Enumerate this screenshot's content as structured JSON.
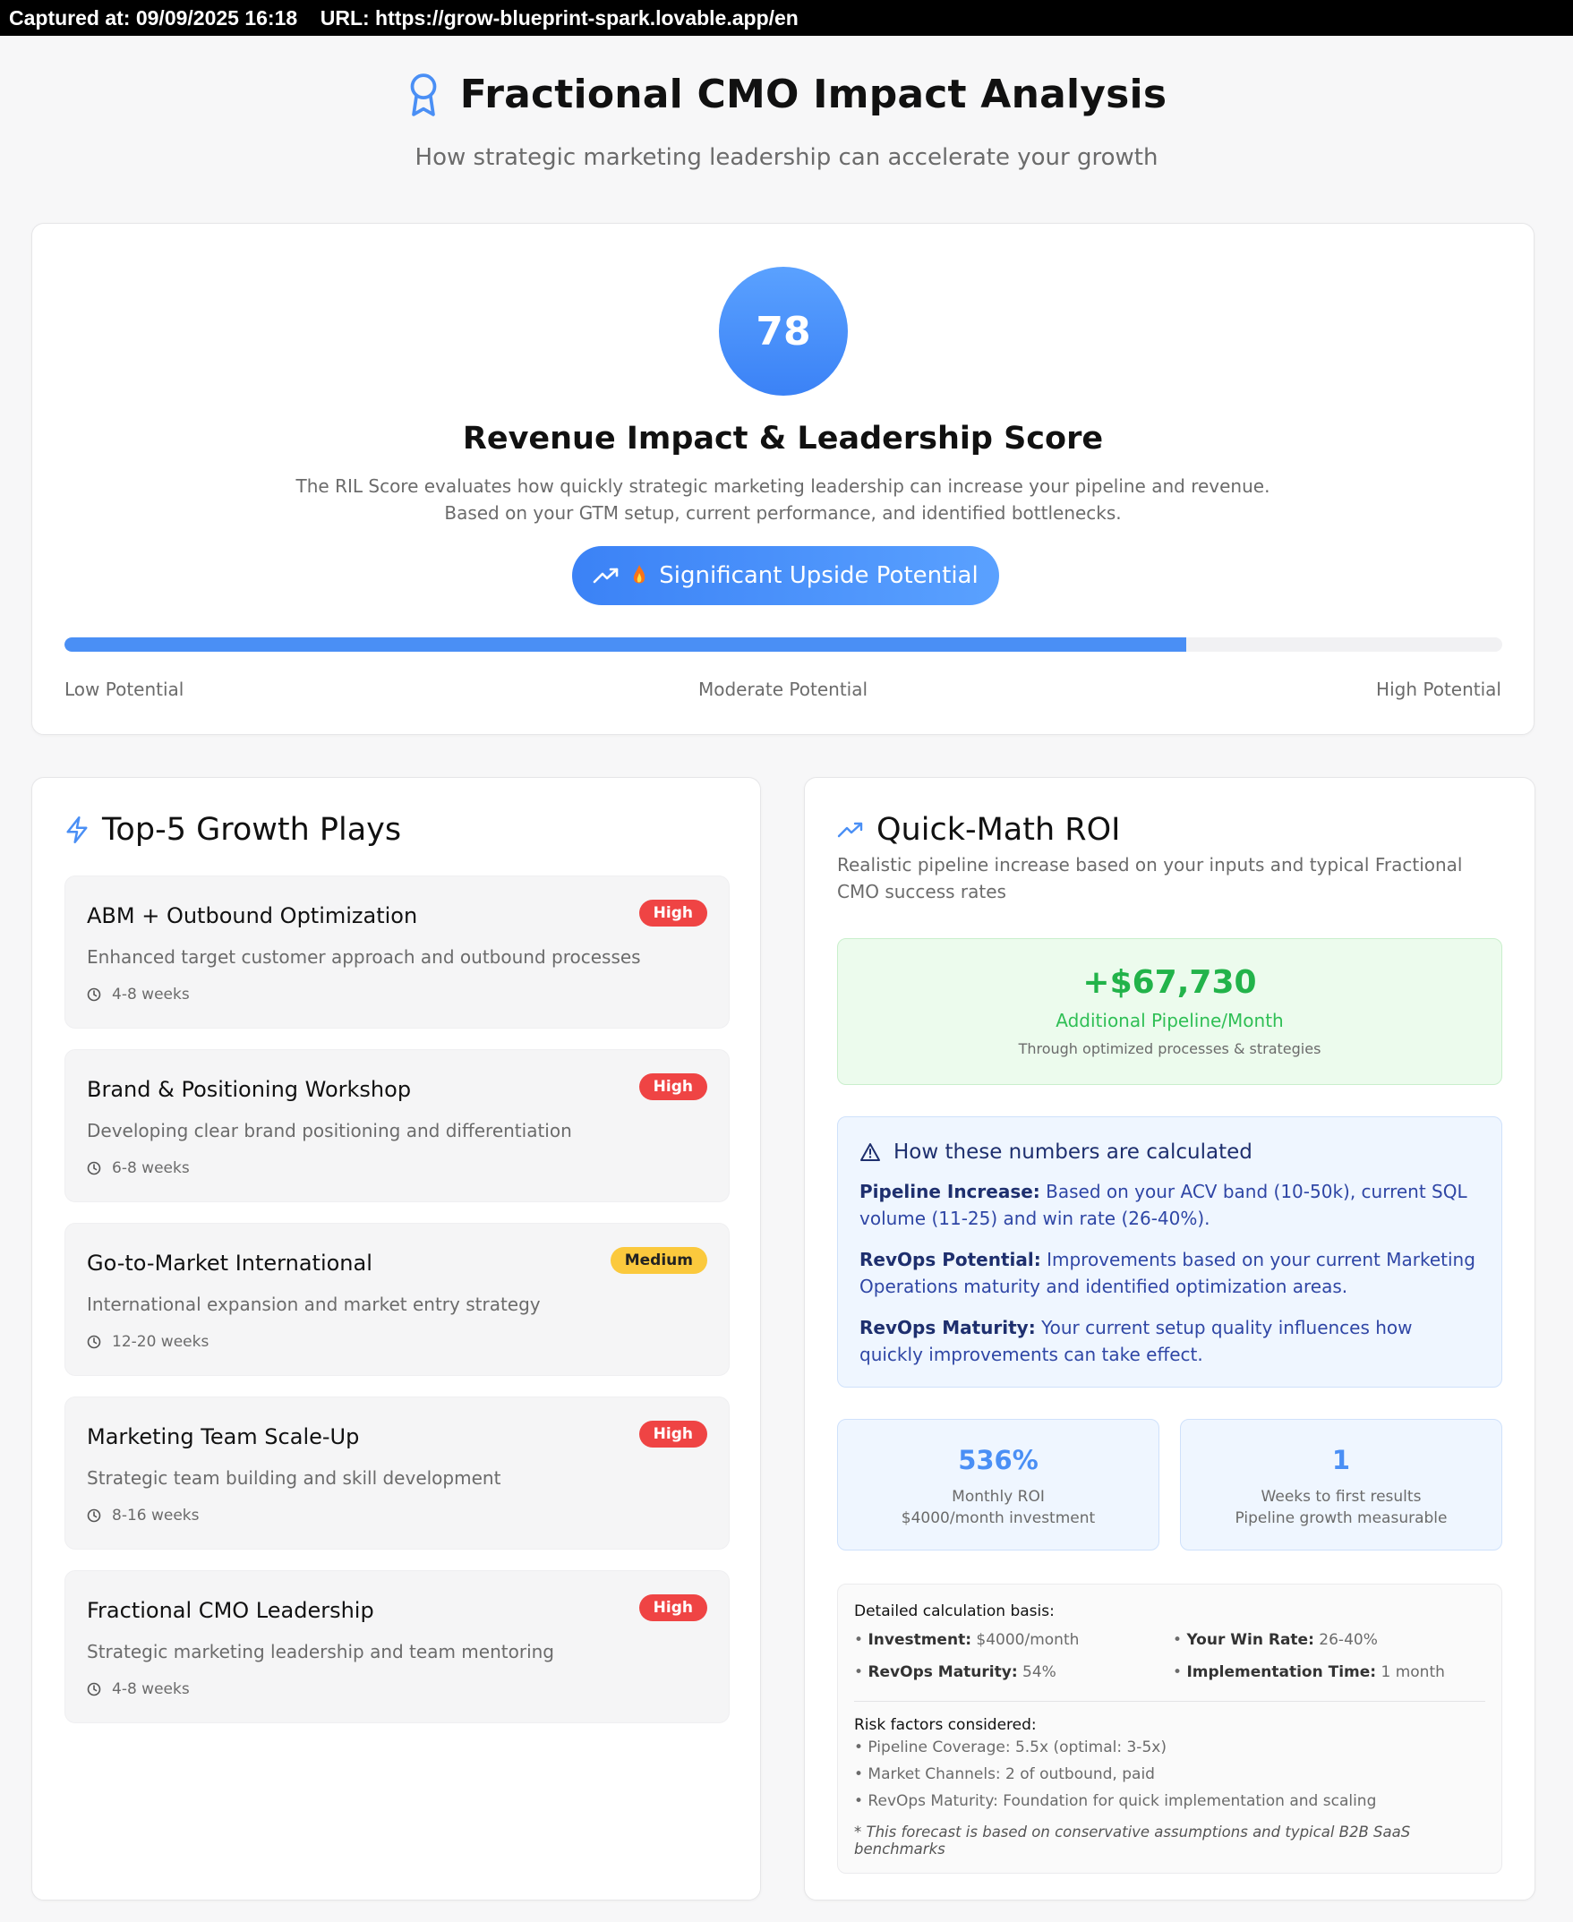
{
  "capture_bar": {
    "text": "Captured at: 09/09/2025 16:18    URL: https://grow-blueprint-spark.lovable.app/en"
  },
  "header": {
    "title": "Fractional CMO Impact Analysis",
    "subtitle": "How strategic marketing leadership can accelerate your growth",
    "icon": "award-icon"
  },
  "score": {
    "value": "78",
    "percent": 78,
    "title": "Revenue Impact & Leadership Score",
    "description_line1": "The RIL Score evaluates how quickly strategic marketing leadership can increase your pipeline and revenue.",
    "description_line2": "Based on your GTM setup, current performance, and identified bottlenecks.",
    "badge_label": "Significant Upside Potential",
    "scale_labels": [
      "Low Potential",
      "Moderate Potential",
      "High Potential"
    ]
  },
  "growth_plays": {
    "title": "Top-5 Growth Plays",
    "icon": "zap-icon",
    "items": [
      {
        "title": "ABM + Outbound Optimization",
        "description": "Enhanced target customer approach and outbound processes",
        "duration": "4-8 weeks",
        "priority": "High"
      },
      {
        "title": "Brand & Positioning Workshop",
        "description": "Developing clear brand positioning and differentiation",
        "duration": "6-8 weeks",
        "priority": "High"
      },
      {
        "title": "Go-to-Market International",
        "description": "International expansion and market entry strategy",
        "duration": "12-20 weeks",
        "priority": "Medium"
      },
      {
        "title": "Marketing Team Scale-Up",
        "description": "Strategic team building and skill development",
        "duration": "8-16 weeks",
        "priority": "High"
      },
      {
        "title": "Fractional CMO Leadership",
        "description": "Strategic marketing leadership and team mentoring",
        "duration": "4-8 weeks",
        "priority": "High"
      }
    ]
  },
  "roi": {
    "title": "Quick-Math ROI",
    "icon": "trending-up-icon",
    "description": "Realistic pipeline increase based on your inputs and typical Fractional CMO success rates",
    "pipeline": {
      "amount": "+$67,730",
      "label": "Additional Pipeline/Month",
      "sub": "Through optimized processes & strategies"
    },
    "calculation": {
      "heading": "How these numbers are calculated",
      "items": [
        {
          "label": "Pipeline Increase:",
          "text": "Based on your ACV band (10-50k), current SQL volume (11-25) and win rate (26-40%)."
        },
        {
          "label": "RevOps Potential:",
          "text": "Improvements based on your current Marketing Operations maturity and identified optimization areas."
        },
        {
          "label": "RevOps Maturity:",
          "text": "Your current setup quality influences how quickly improvements can take effect."
        }
      ]
    },
    "stats": [
      {
        "value": "536%",
        "label": "Monthly ROI",
        "sub": "$4000/month investment"
      },
      {
        "value": "1",
        "label": "Weeks to first results",
        "sub": "Pipeline growth measurable"
      }
    ],
    "basis": {
      "heading": "Detailed calculation basis:",
      "items": [
        {
          "label": "Investment:",
          "value": "$4000/month"
        },
        {
          "label": "Your Win Rate:",
          "value": "26-40%"
        },
        {
          "label": "RevOps Maturity:",
          "value": "54%"
        },
        {
          "label": "Implementation Time:",
          "value": "1 month"
        }
      ],
      "risk_heading": "Risk factors considered:",
      "risks": [
        "• Pipeline Coverage: 5.5x (optimal: 3-5x)",
        "• Market Channels: 2 of outbound, paid",
        "• RevOps Maturity: Foundation for quick implementation and scaling"
      ],
      "footnote": "* This forecast is based on conservative assumptions and typical B2B SaaS benchmarks"
    }
  },
  "colors": {
    "accent": "#3b82f6",
    "high_badge": "#ef4444",
    "medium_badge": "#fbc93d",
    "success": "#22b34a"
  }
}
